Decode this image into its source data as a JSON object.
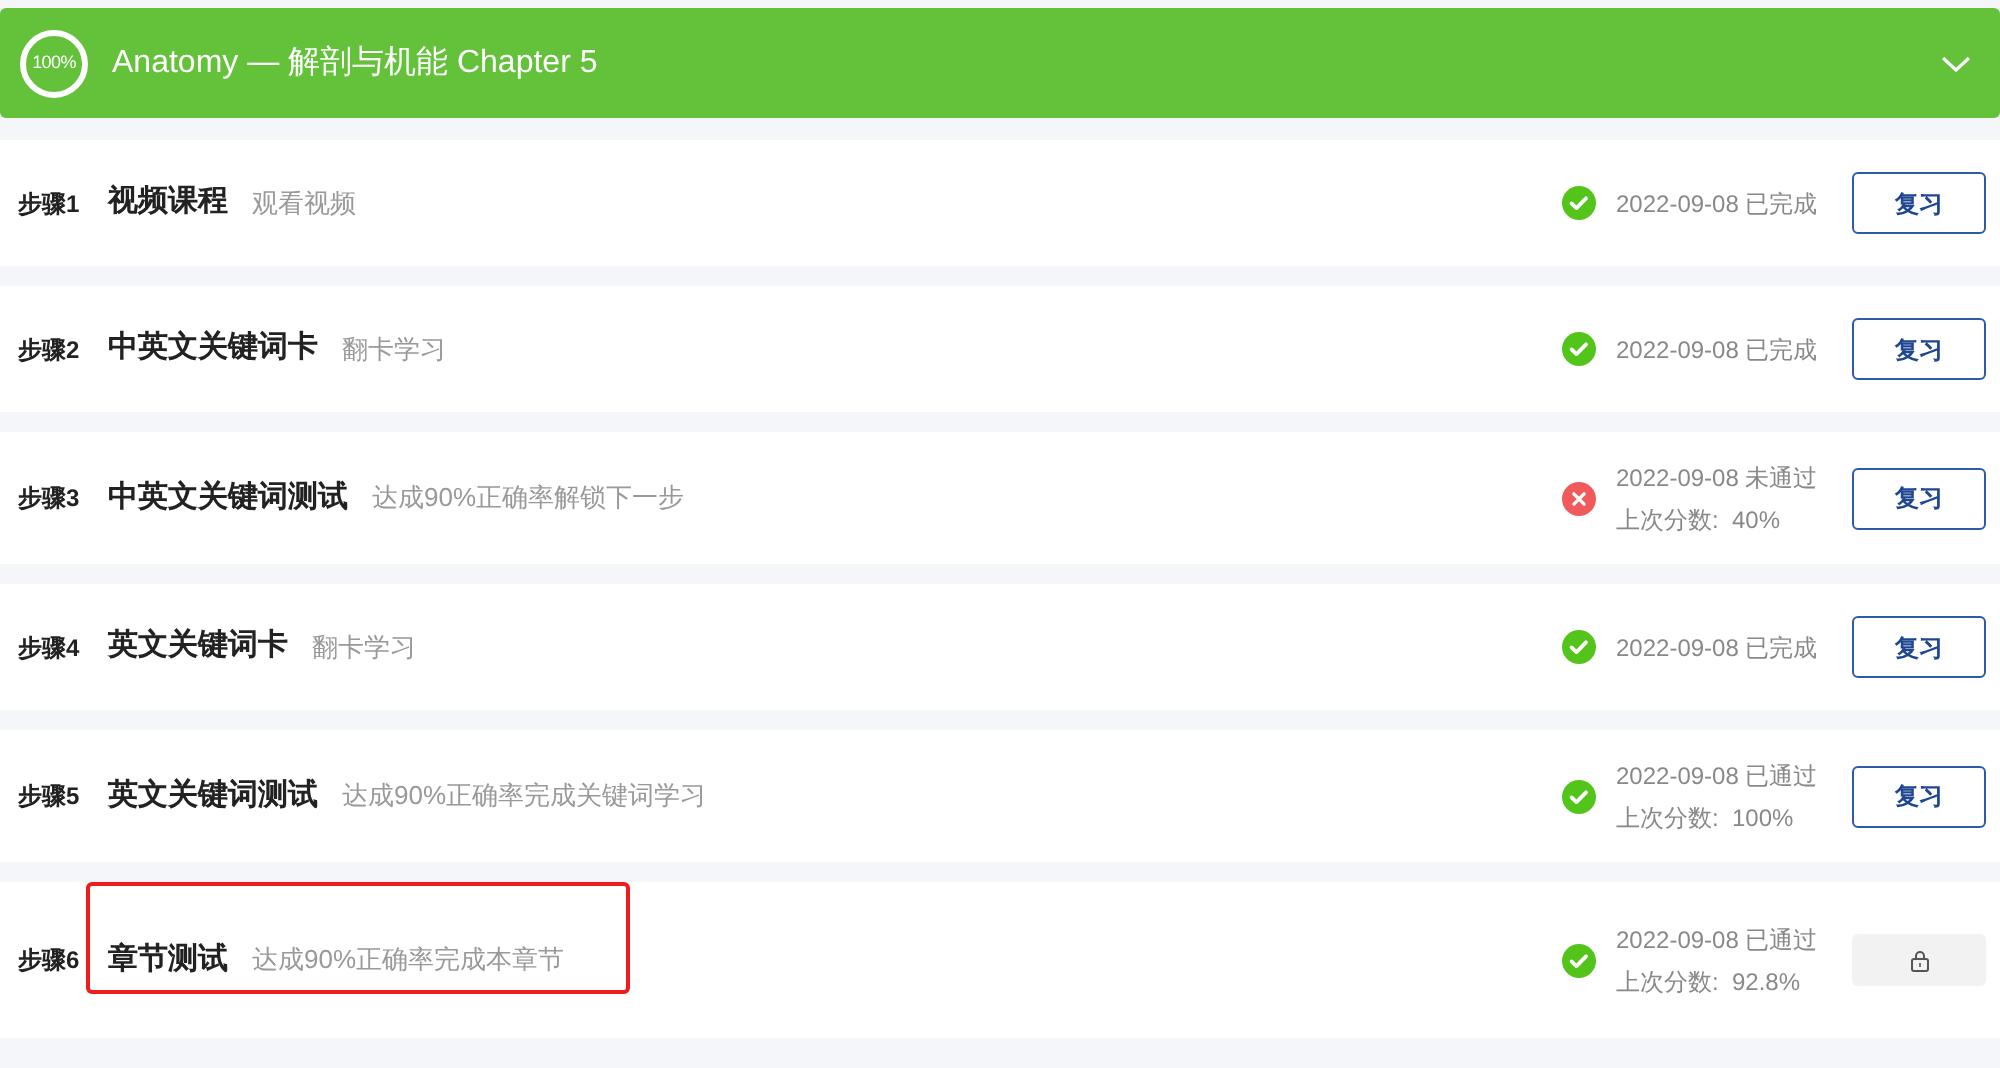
{
  "header": {
    "progress": "100%",
    "title": "Anatomy — 解剖与机能 Chapter 5",
    "expanded": true
  },
  "steps": [
    {
      "step": "步骤1",
      "title": "视频课程",
      "hint": "观看视频",
      "passed": true,
      "result": "2022-09-08 已完成",
      "action": {
        "kind": "review",
        "label": "复习"
      },
      "highlighted": false
    },
    {
      "step": "步骤2",
      "title": "中英文关键词卡",
      "hint": "翻卡学习",
      "passed": true,
      "result": "2022-09-08 已完成",
      "action": {
        "kind": "review",
        "label": "复习"
      },
      "highlighted": false
    },
    {
      "step": "步骤3",
      "title": "中英文关键词测试",
      "hint": "达成90%正确率解锁下一步",
      "passed": false,
      "result": "2022-09-08 未通过",
      "score": "上次分数:  40%",
      "action": {
        "kind": "review",
        "label": "复习"
      },
      "highlighted": false
    },
    {
      "step": "步骤4",
      "title": "英文关键词卡",
      "hint": "翻卡学习",
      "passed": true,
      "result": "2022-09-08 已完成",
      "action": {
        "kind": "review",
        "label": "复习"
      },
      "highlighted": false
    },
    {
      "step": "步骤5",
      "title": "英文关键词测试",
      "hint": "达成90%正确率完成关键词学习",
      "passed": true,
      "result": "2022-09-08 已通过",
      "score": "上次分数:  100%",
      "action": {
        "kind": "review",
        "label": "复习"
      },
      "highlighted": false
    },
    {
      "step": "步骤6",
      "title": "章节测试",
      "hint": "达成90%正确率完成本章节",
      "passed": true,
      "result": "2022-09-08 已通过",
      "score": "上次分数:  92.8%",
      "action": {
        "kind": "locked"
      },
      "highlighted": true
    }
  ]
}
